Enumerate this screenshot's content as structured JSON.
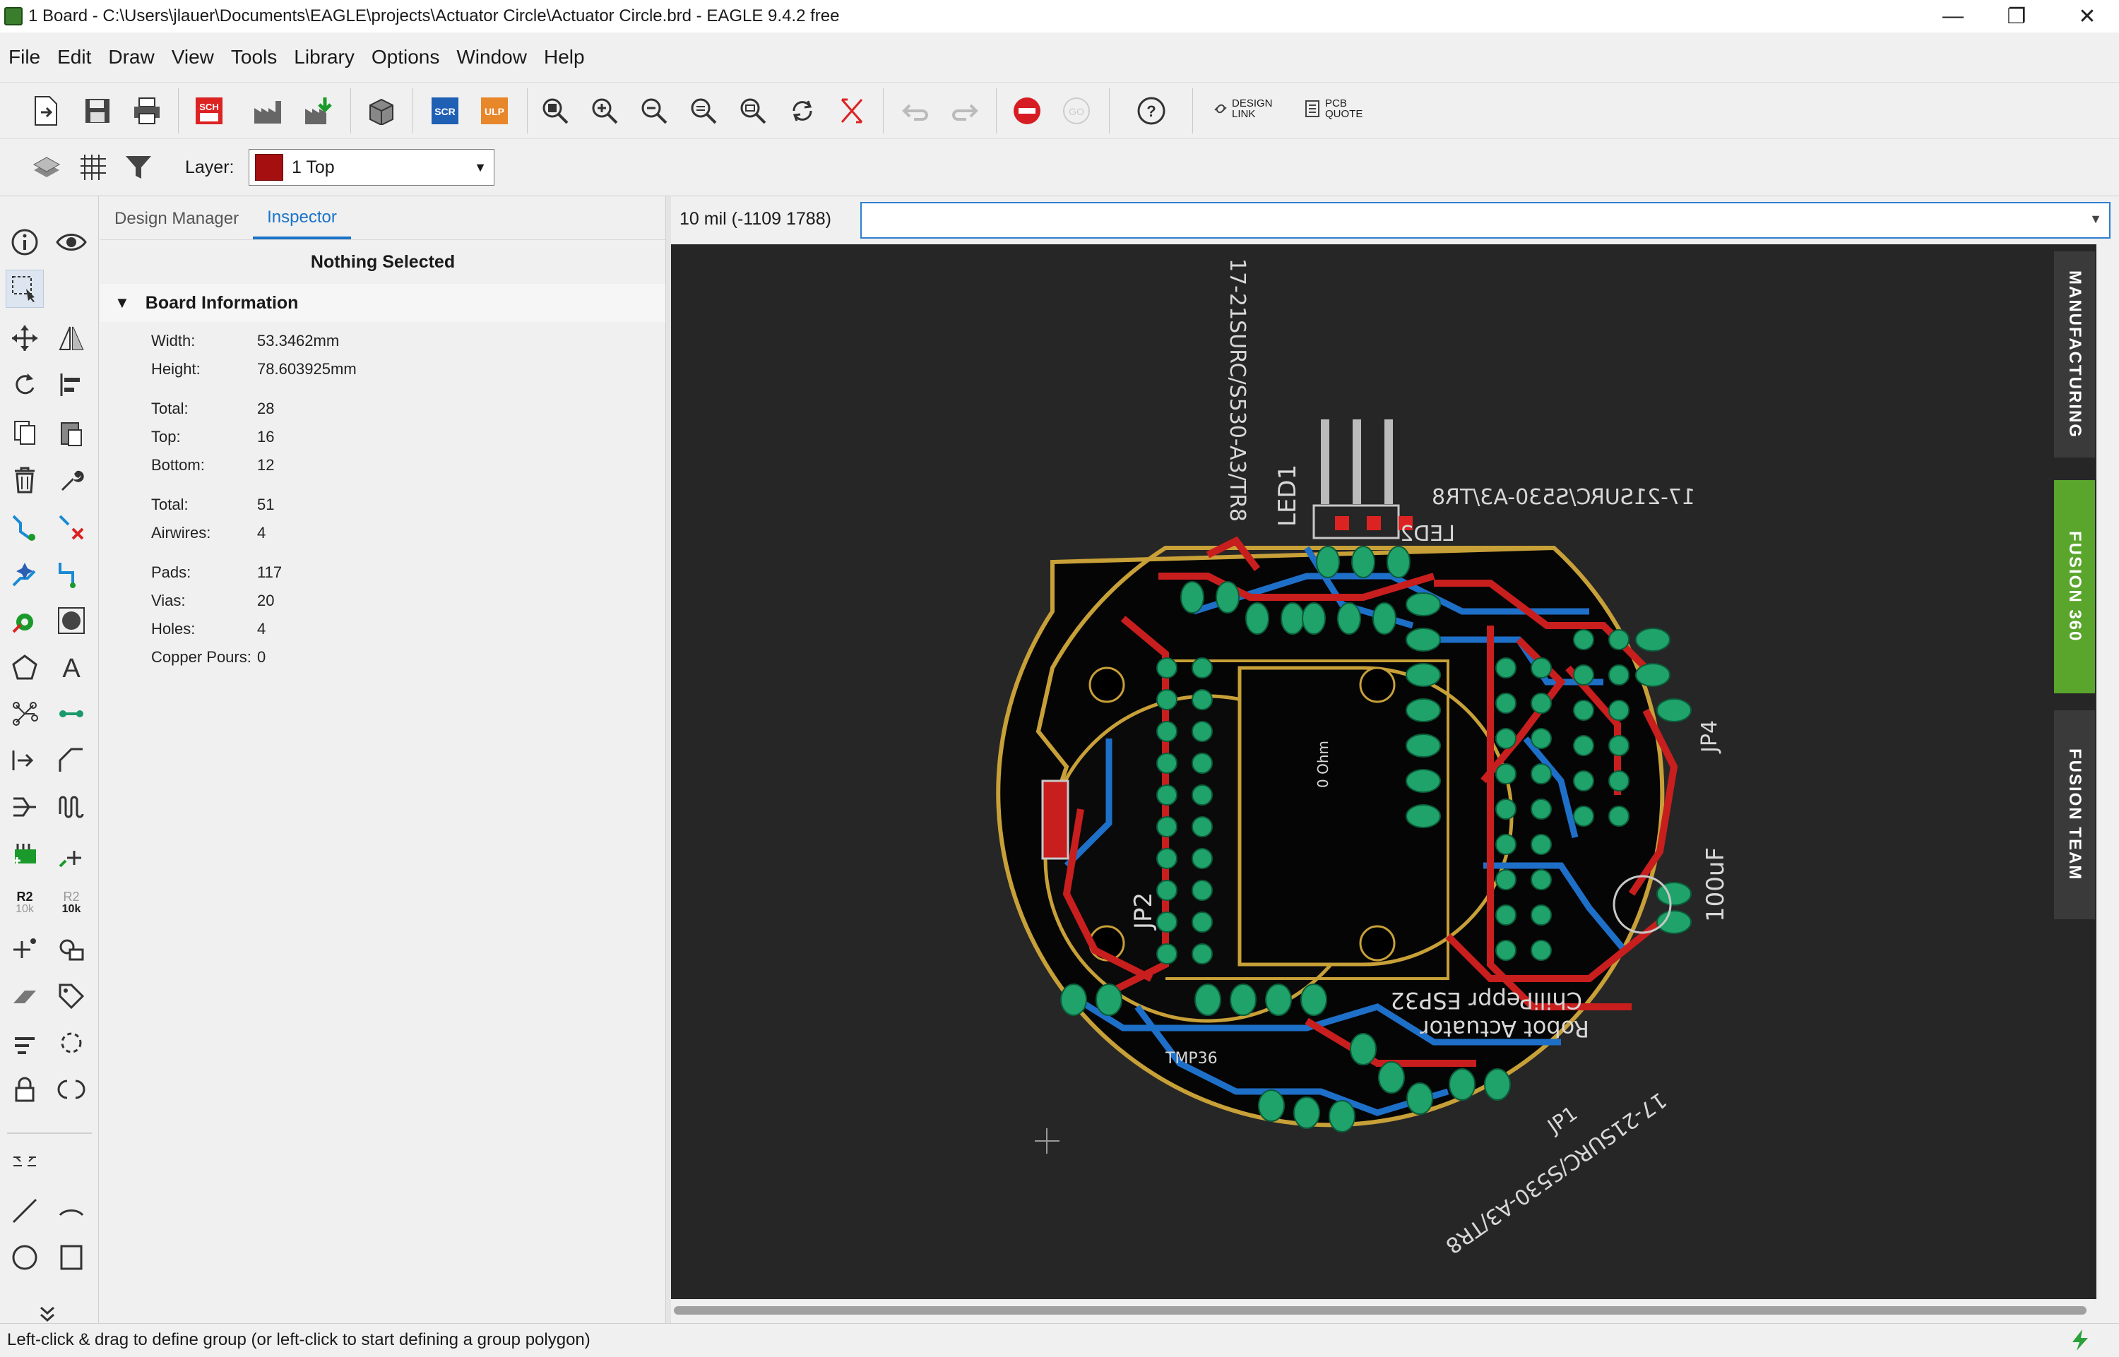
{
  "window": {
    "title": "1 Board - C:\\Users\\jlauer\\Documents\\EAGLE\\projects\\Actuator Circle\\Actuator Circle.brd - EAGLE 9.4.2 free"
  },
  "menu": [
    "File",
    "Edit",
    "Draw",
    "View",
    "Tools",
    "Library",
    "Options",
    "Window",
    "Help"
  ],
  "toolbar": {
    "sch_label": "SCH",
    "scr_label": "SCR",
    "ulp_label": "ULP",
    "design_link": "DESIGN\nLINK",
    "pcb_quote": "PCB\nQUOTE"
  },
  "layer_toolbar": {
    "label": "Layer:",
    "selected": "1 Top",
    "color": "#a50f0f"
  },
  "panel": {
    "tabs": [
      "Design Manager",
      "Inspector"
    ],
    "active_tab": "Inspector",
    "selection_title": "Nothing Selected",
    "section_title": "Board Information",
    "properties": [
      {
        "label": "Width:",
        "value": "53.3462mm"
      },
      {
        "label": "Height:",
        "value": "78.603925mm"
      },
      {
        "label": "Total:",
        "value": "28"
      },
      {
        "label": "Top:",
        "value": "16"
      },
      {
        "label": "Bottom:",
        "value": "12"
      },
      {
        "label": "Total:",
        "value": "51"
      },
      {
        "label": "Airwires:",
        "value": "4"
      },
      {
        "label": "Pads:",
        "value": "117"
      },
      {
        "label": "Vias:",
        "value": "20"
      },
      {
        "label": "Holes:",
        "value": "4"
      },
      {
        "label": "Copper Pours:",
        "value": "0"
      }
    ]
  },
  "coord_readout": "10 mil (-1109 1788)",
  "command_input": "",
  "right_tabs": [
    "MANUFACTURING",
    "FUSION 360",
    "FUSION TEAM"
  ],
  "left_tools": {
    "r2_label": "R2",
    "r2_val": "10k"
  },
  "board_labels": {
    "part1": "17-21SURC/S530-A3/TR8",
    "part2": "17-21SURC/S530-A3/TR8",
    "part3": "17-21SURC/S530-A3/TR8",
    "led": "LED1",
    "led2": "LED2",
    "jp2": "JP2",
    "jp4": "JP4",
    "jp1": "JP1",
    "cap": "100uF",
    "ohm": "0 Ohm",
    "tmp": "TMP36",
    "brand1": "ChiliPeppr ESP32",
    "brand2": "Robot Actuator"
  },
  "status": "Left-click & drag to define group (or left-click to start defining a group polygon)",
  "colors": {
    "canvas_bg": "#262626",
    "top_copper": "#c81e1e",
    "bottom_copper": "#1e6fc8",
    "pad": "#1fa36a",
    "outline": "#c8a038",
    "accent": "#1a73c8"
  }
}
